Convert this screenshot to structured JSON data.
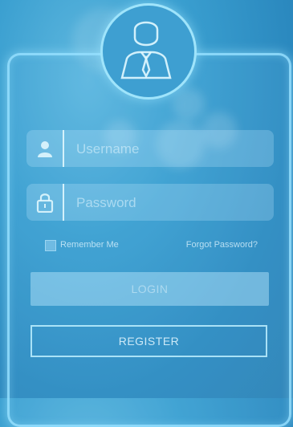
{
  "login_form": {
    "username_placeholder": "Username",
    "password_placeholder": "Password",
    "remember_label": "Remember Me",
    "forgot_label": "Forgot Password?",
    "login_label": "LOGIN",
    "register_label": "REGISTER"
  },
  "icons": {
    "avatar": "user-avatar-icon",
    "username": "user-icon",
    "password": "lock-icon"
  },
  "colors": {
    "background": "#3a9fd0",
    "panel_border": "#96e1ff",
    "text": "#e1f5ff"
  }
}
